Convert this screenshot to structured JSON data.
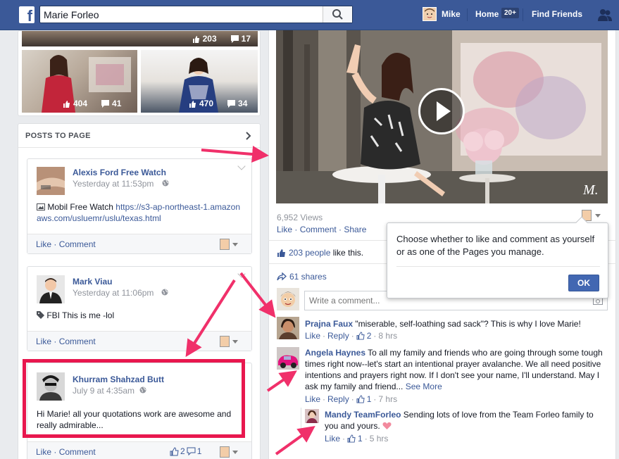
{
  "header": {
    "search_value": "Marie Forleo",
    "user_name": "Mike",
    "home_label": "Home",
    "home_badge": "20+",
    "find_friends_label": "Find Friends"
  },
  "photos": {
    "top_row": {
      "likes": "203",
      "comments": "17"
    },
    "items": [
      {
        "likes": "404",
        "comments": "41"
      },
      {
        "likes": "470",
        "comments": "34"
      }
    ]
  },
  "posts_to_page": {
    "title": "POSTS TO PAGE",
    "posts": [
      {
        "author": "Alexis Ford Free Watch",
        "time": "Yesterday at 11:53pm",
        "text_prefix": "Mobil Free Watch ",
        "link": "https://s3-ap-northeast-1.amazonaws.com/usluemr/uslu/texas.html",
        "like": "Like",
        "comment": "Comment"
      },
      {
        "author": "Mark Viau",
        "time": "Yesterday at 11:06pm",
        "text": "FBI This is me -lol",
        "like": "Like",
        "comment": "Comment"
      },
      {
        "author": "Khurram Shahzad Butt",
        "time": "July 9 at 4:35am",
        "text": "Hi Marie! all your quotations work are awesome and really admirable...",
        "like": "Like",
        "comment": "Comment",
        "like_count": "2",
        "comment_count": "1"
      }
    ]
  },
  "video_post": {
    "views": "6,952 Views",
    "actions": [
      "Like",
      "Comment",
      "Share"
    ],
    "likes_prefix": "203 people",
    "likes_suffix": " like this.",
    "shares": "61 shares",
    "comment_placeholder": "Write a comment...",
    "watermark": "M."
  },
  "tooltip": {
    "text": "Choose whether to like and comment as yourself or as one of the Pages you manage.",
    "ok": "OK"
  },
  "comments": [
    {
      "name": "Prajna Faux",
      "text": " \"miserable, self-loathing sad sack\"? This is why I love Marie!",
      "like": "Like",
      "reply": "Reply",
      "likes": "2",
      "time": "8 hrs"
    },
    {
      "name": "Angela Haynes",
      "text": " To all my family and friends who are going through some tough times right now--let's start an intentional prayer avalanche. We all need positive intentions and prayers right now. If I don't see your name, I'll understand. May I ask my family and friend...",
      "see_more": " See More",
      "like": "Like",
      "reply": "Reply",
      "likes": "1",
      "time": "7 hrs"
    },
    {
      "name": "Mandy TeamForleo",
      "text": " Sending lots of love from the Team Forleo family to you and yours.",
      "like": "Like",
      "likes": "1",
      "time": "5 hrs"
    }
  ],
  "colors": {
    "facebook_blue": "#3b5998",
    "highlight_box": "#e8174e",
    "annotation_arrow": "#f0306a"
  }
}
